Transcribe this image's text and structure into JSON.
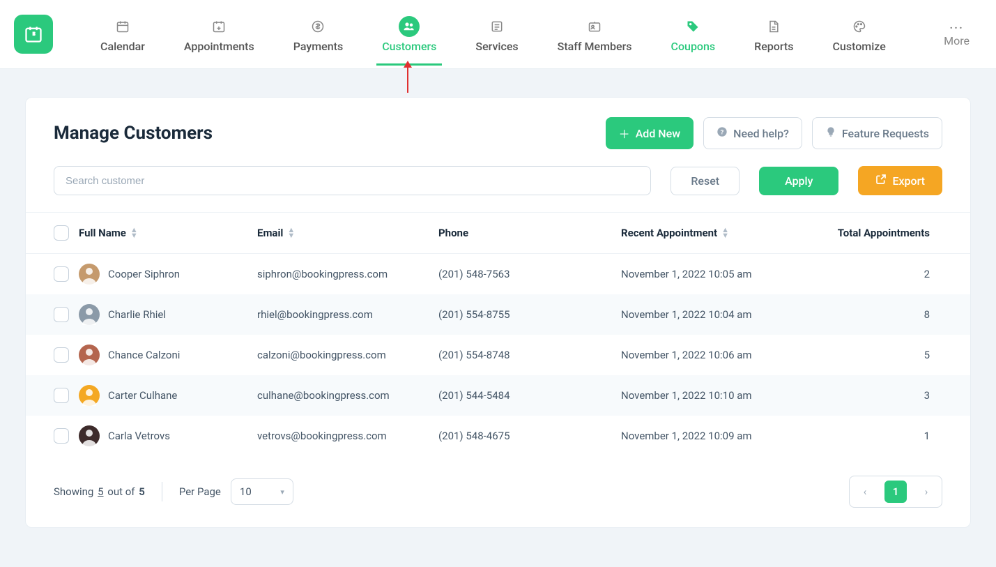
{
  "nav": [
    {
      "label": "Calendar",
      "icon": "calendar"
    },
    {
      "label": "Appointments",
      "icon": "calendar-plus"
    },
    {
      "label": "Payments",
      "icon": "dollar"
    },
    {
      "label": "Customers",
      "icon": "users",
      "active": true
    },
    {
      "label": "Services",
      "icon": "list"
    },
    {
      "label": "Staff Members",
      "icon": "id"
    },
    {
      "label": "Coupons",
      "icon": "tag",
      "highlight": true
    },
    {
      "label": "Reports",
      "icon": "doc"
    },
    {
      "label": "Customize",
      "icon": "palette"
    }
  ],
  "more_label": "More",
  "page": {
    "title": "Manage Customers",
    "add_new": "Add New",
    "need_help": "Need help?",
    "feature_requests": "Feature Requests"
  },
  "search": {
    "placeholder": "Search customer"
  },
  "buttons": {
    "reset": "Reset",
    "apply": "Apply",
    "export": "Export"
  },
  "columns": {
    "full_name": "Full Name",
    "email": "Email",
    "phone": "Phone",
    "recent": "Recent Appointment",
    "total": "Total Appointments"
  },
  "rows": [
    {
      "name": "Cooper Siphron",
      "email": "siphron@bookingpress.com",
      "phone": "(201) 548-7563",
      "recent": "November 1, 2022 10:05 am",
      "total": "2",
      "avatar_color": "#c59a6d"
    },
    {
      "name": "Charlie Rhiel",
      "email": "rhiel@bookingpress.com",
      "phone": "(201) 554-8755",
      "recent": "November 1, 2022 10:04 am",
      "total": "8",
      "avatar_color": "#8b9aa8"
    },
    {
      "name": "Chance Calzoni",
      "email": "calzoni@bookingpress.com",
      "phone": "(201) 554-8748",
      "recent": "November 1, 2022 10:06 am",
      "total": "5",
      "avatar_color": "#b4654e"
    },
    {
      "name": "Carter Culhane",
      "email": "culhane@bookingpress.com",
      "phone": "(201) 544-5484",
      "recent": "November 1, 2022 10:10 am",
      "total": "3",
      "avatar_color": "#f4a823"
    },
    {
      "name": "Carla Vetrovs",
      "email": "vetrovs@bookingpress.com",
      "phone": "(201) 548-4675",
      "recent": "November 1, 2022 10:09 am",
      "total": "1",
      "avatar_color": "#3d2b2b"
    }
  ],
  "footer": {
    "showing_prefix": "Showing",
    "showing_count": "5",
    "showing_middle": "out of",
    "showing_total": "5",
    "per_page_label": "Per Page",
    "per_page_value": "10",
    "current_page": "1"
  }
}
